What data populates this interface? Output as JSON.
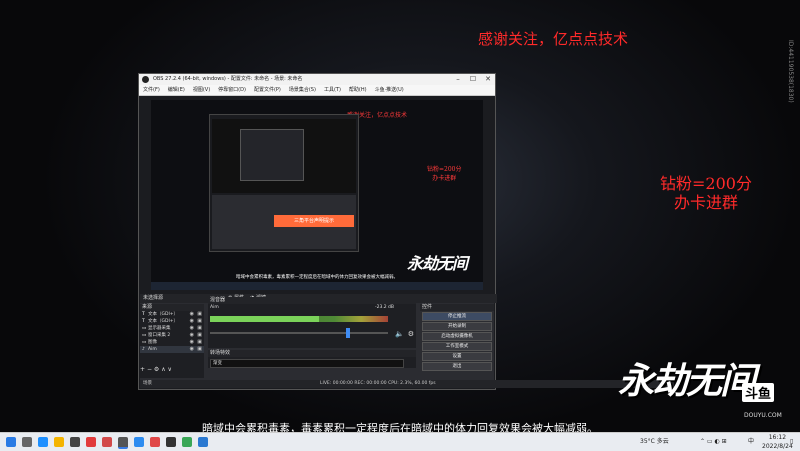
{
  "stream": {
    "top_text": "感谢关注，亿点点技术",
    "right_text_1": "钻粉=200分",
    "right_text_2": "办卡进群",
    "side_id": "ID:441190538(1830)",
    "logo_text": "永劫无间",
    "douyu_badge": "斗鱼",
    "douyu_url": "DOUYU.COM",
    "subtitle": "暗域中会累积毒素，毒素累积一定程度后在暗域中的体力回复效果会被大幅减弱。"
  },
  "obs": {
    "title": "OBS 27.2.4 (64-bit, windows) - 配置文件: 未命名 - 场景: 未命名",
    "menu": [
      "文件(F)",
      "编辑(E)",
      "视图(V)",
      "停靠窗口(D)",
      "配置文件(P)",
      "场景集合(S)",
      "工具(T)",
      "帮助(H)",
      "斗鱼·推送(U)"
    ],
    "preview_text_top": "感谢关注，亿点点技术",
    "preview_text_right_1": "钻粉=200分",
    "preview_text_right_2": "办卡进群",
    "preview_orange_box": "三角平台声明提示",
    "preview_logo": "永劫无间",
    "preview_subtitle": "暗域中会累积毒素，毒素累积一定程度后在暗域中的体力回复效果会被大幅减弱。",
    "scenes_label": "未选择源",
    "props_tab": "属性",
    "filter_tab": "滤镜",
    "sources_header": "来源",
    "sources": [
      {
        "icon": "T",
        "name": "文本（GDI+）"
      },
      {
        "icon": "T",
        "name": "文本（GDI+）"
      },
      {
        "icon": "▭",
        "name": "显示器采集"
      },
      {
        "icon": "▭",
        "name": "窗口采集 2"
      },
      {
        "icon": "▭",
        "name": "图像"
      },
      {
        "icon": "♪",
        "name": "Aim"
      }
    ],
    "mixer_header": "混音器",
    "mixer_track": "Aim",
    "mixer_db": "-23.2 dB",
    "mixer_level": 0.61,
    "mixer_slider": 0.78,
    "transition_header": "转场特效",
    "transition_value": "渐变",
    "controls_header": "控件",
    "controls": [
      "停止推流",
      "开始录制",
      "启动虚拟摄像机",
      "工作室模式",
      "设置",
      "退出"
    ],
    "scene_item": "场景",
    "status_live": "LIVE: 00:00:00",
    "status_rec": "REC: 00:00:00",
    "status_cpu": "CPU: 2.3%, 60.00 fps"
  },
  "taskbar": {
    "weather": "35°C 多云",
    "time": "16:12",
    "date": "2022/8/24",
    "ime": "中"
  },
  "colors": {
    "stream_red": "#ff2a2a",
    "obs_dark": "#1b1c20",
    "meter_green": "#7bd35a",
    "active_btn": "#3d4b63"
  }
}
